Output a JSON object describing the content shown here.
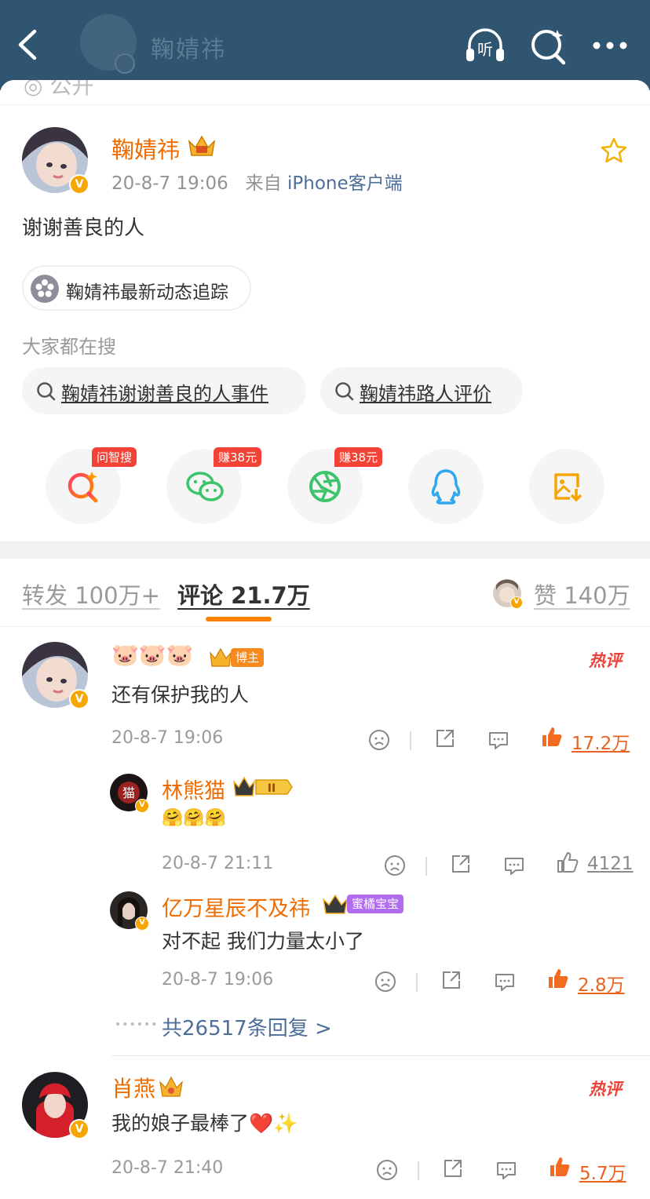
{
  "header": {
    "title": "鞠婧祎",
    "listen_label": "听"
  },
  "post": {
    "author": "鞠婧祎",
    "time": "20-8-7 19:06",
    "source_prefix": "来自",
    "source": "iPhone客户端",
    "text": "谢谢善良的人",
    "topic_chip": "鞠婧祎最新动态追踪",
    "search_heading": "大家都在搜",
    "search_chips": [
      "鞠婧祎谢谢善良的人事件",
      "鞠婧祎路人评价"
    ],
    "share": [
      {
        "name": "问智搜",
        "tag": "问智搜"
      },
      {
        "name": "wechat",
        "tag": "赚38元"
      },
      {
        "name": "moments",
        "tag": "赚38元"
      },
      {
        "name": "qq",
        "tag": ""
      },
      {
        "name": "save-image",
        "tag": ""
      }
    ]
  },
  "tabs": {
    "repost": "转发 100万+",
    "comment": "评论 21.7万",
    "like": "赞 140万"
  },
  "comments": [
    {
      "author": "🐷🐷🐷",
      "badge": "博主",
      "hot": "热评",
      "text": "还有保护我的人",
      "time": "20-8-7 19:06",
      "likes": "17.2万",
      "replies": [
        {
          "author": "林熊猫",
          "text": "🤗🤗🤗",
          "time": "20-8-7 21:11",
          "likes": "4121"
        },
        {
          "author": "亿万星辰不及祎",
          "badge": "蜜橘宝宝",
          "text": "对不起 我们力量太小了",
          "time": "20-8-7 19:06",
          "likes": "2.8万"
        }
      ],
      "more_replies": "共26517条回复 >"
    },
    {
      "author": "肖燕",
      "hot": "热评",
      "text": "我的娘子最棒了❤️✨",
      "time": "20-8-7 21:40",
      "likes": "5.7万"
    }
  ],
  "colors": {
    "accent_orange": "#ff8200",
    "name_orange": "#ef6b00",
    "link_blue": "#4d6e9a",
    "header_bg": "#2f5570"
  }
}
